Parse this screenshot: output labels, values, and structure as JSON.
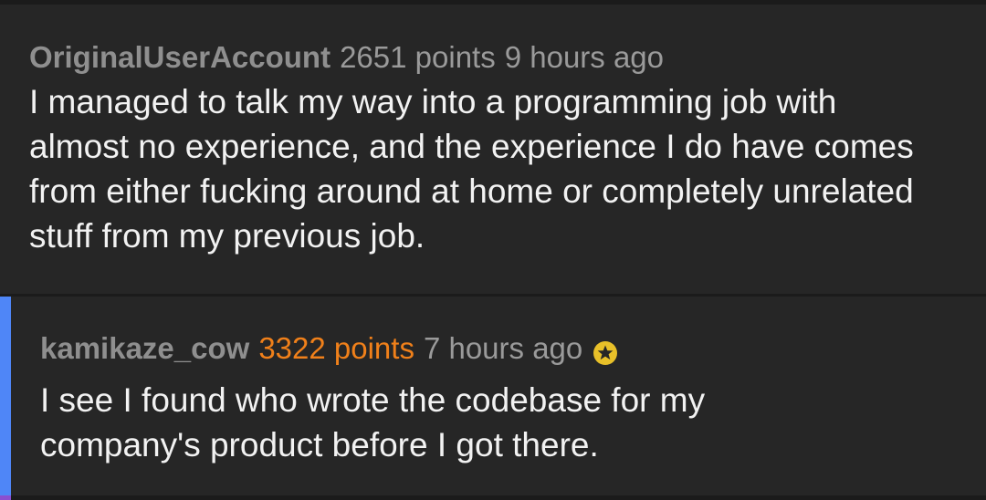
{
  "colors": {
    "background": "#262626",
    "reply_indent_bar": "#4f86f7",
    "score_highlight": "#f0801a",
    "award_gold": "#e8c029"
  },
  "comments": [
    {
      "author": "OriginalUserAccount",
      "score": "2651 points",
      "time": "9 hours ago",
      "body": "I managed to talk my way into a programming job with almost no experience, and the experience I do have comes from either fucking around at home or completely unrelated stuff from my previous job."
    },
    {
      "author": "kamikaze_cow",
      "score": "3322 points",
      "time": "7 hours ago",
      "award_icon": "star-award-icon",
      "body": "I see I found who wrote the codebase for my company's product before I got there."
    }
  ]
}
